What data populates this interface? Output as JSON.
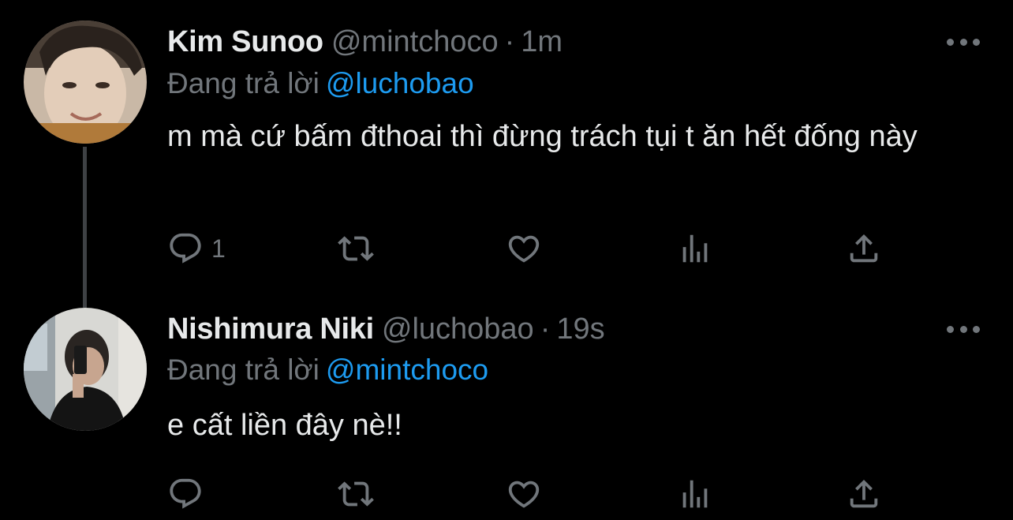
{
  "reply_prefix": "Đang trả lời",
  "tweets": [
    {
      "display_name": "Kim Sunoo",
      "handle": "@mintchoco",
      "separator": "·",
      "time": "1m",
      "reply_to": "@luchobao",
      "text": "m mà cứ bấm đthoai thì đừng trách tụi t ăn hết đống này",
      "reply_count": "1"
    },
    {
      "display_name": "Nishimura Niki",
      "handle": "@luchobao",
      "separator": "·",
      "time": "19s",
      "reply_to": "@mintchoco",
      "text": "e cất liền đây nè!!",
      "reply_count": ""
    }
  ],
  "icons": {
    "reply": "reply-icon",
    "retweet": "retweet-icon",
    "like": "heart-icon",
    "views": "views-icon",
    "share": "share-icon",
    "more": "more-icon"
  },
  "colors": {
    "background": "#000000",
    "text_primary": "#e7e9ea",
    "text_secondary": "#71767b",
    "accent": "#1d9bf0",
    "thread_line": "#3e4144"
  }
}
